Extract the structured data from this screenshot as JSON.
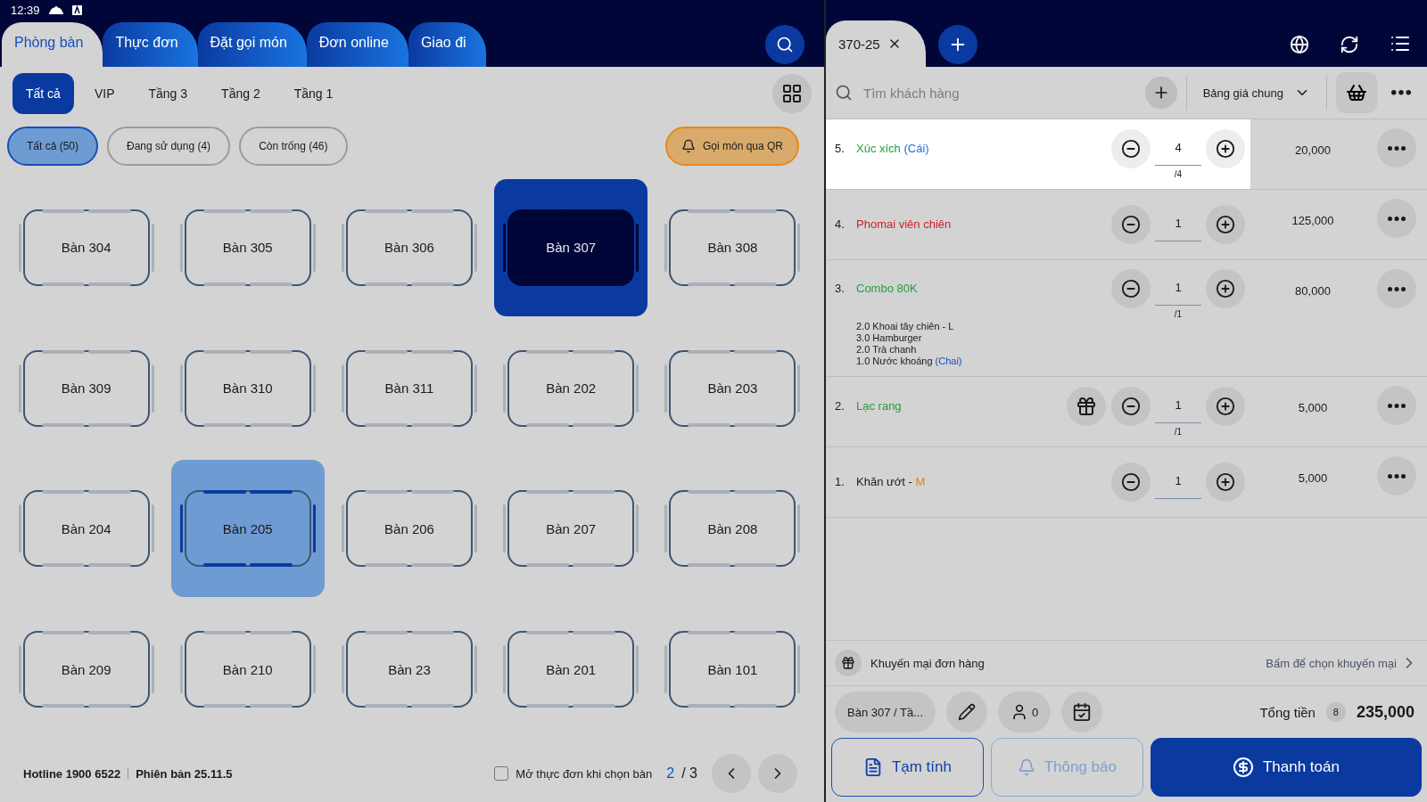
{
  "status_bar": {
    "time": "12:39"
  },
  "left": {
    "tabs": [
      {
        "label": "Phòng bàn",
        "selected": true
      },
      {
        "label": "Thực đơn",
        "selected": false
      },
      {
        "label": "Đặt gọi món",
        "selected": false
      },
      {
        "label": "Đơn online",
        "selected": false
      },
      {
        "label": "Giao đi",
        "selected": false
      }
    ],
    "floors": [
      {
        "label": "Tất cả",
        "selected": true
      },
      {
        "label": "VIP",
        "selected": false
      },
      {
        "label": "Tầng 3",
        "selected": false
      },
      {
        "label": "Tầng 2",
        "selected": false
      },
      {
        "label": "Tầng 1",
        "selected": false
      }
    ],
    "filters": [
      {
        "label": "Tất cả (50)",
        "selected": true
      },
      {
        "label": "Đang sử dụng (4)",
        "selected": false
      },
      {
        "label": "Còn trống (46)",
        "selected": false
      }
    ],
    "qr_button": "Gọi món qua QR",
    "tables": [
      {
        "label": "Bàn 304",
        "open": false,
        "selected": false
      },
      {
        "label": "Bàn 305",
        "open": false,
        "selected": false
      },
      {
        "label": "Bàn 306",
        "open": false,
        "selected": false
      },
      {
        "label": "Bàn 307",
        "open": true,
        "selected": false
      },
      {
        "label": "Bàn 308",
        "open": false,
        "selected": false
      },
      {
        "label": "Bàn 309",
        "open": false,
        "selected": false
      },
      {
        "label": "Bàn 310",
        "open": false,
        "selected": false
      },
      {
        "label": "Bàn 311",
        "open": false,
        "selected": false
      },
      {
        "label": "Bàn 202",
        "open": false,
        "selected": false
      },
      {
        "label": "Bàn 203",
        "open": false,
        "selected": false
      },
      {
        "label": "Bàn 204",
        "open": false,
        "selected": false
      },
      {
        "label": "Bàn 205",
        "open": false,
        "selected": true
      },
      {
        "label": "Bàn 206",
        "open": false,
        "selected": false
      },
      {
        "label": "Bàn 207",
        "open": false,
        "selected": false
      },
      {
        "label": "Bàn 208",
        "open": false,
        "selected": false
      },
      {
        "label": "Bàn 209",
        "open": false,
        "selected": false
      },
      {
        "label": "Bàn 210",
        "open": false,
        "selected": false
      },
      {
        "label": "Bàn 23",
        "open": false,
        "selected": false
      },
      {
        "label": "Bàn 201",
        "open": false,
        "selected": false
      },
      {
        "label": "Bàn 101",
        "open": false,
        "selected": false
      }
    ],
    "footer": {
      "hotline": "Hotline 1900 6522",
      "version": "Phiên bản 25.11.5",
      "open_menu_label": "Mở thực đơn khi chọn bàn",
      "open_menu_checked": false,
      "page_current": "2",
      "page_total": "/ 3"
    }
  },
  "right": {
    "order_tab": {
      "label": "370-25",
      "selected": true
    },
    "customer_search": {
      "placeholder": "Tìm khách hàng"
    },
    "price_list": "Bảng giá chung",
    "items": [
      {
        "number": "5.",
        "name": "Xúc xích",
        "color": "#22a03c",
        "suffix": {
          "text": "(Cái)",
          "color": "#1e6fd0"
        },
        "qty": "4",
        "limit": "/4",
        "price": "20,000",
        "selected": true,
        "gift": false
      },
      {
        "number": "4.",
        "name": "Phomai viên chiên",
        "color": "#d0202c",
        "qty": "1",
        "price": "125,000",
        "selected": false,
        "gift": false
      },
      {
        "number": "3.",
        "name": "Combo 80K",
        "color": "#22a03c",
        "qty": "1",
        "limit": "/1",
        "price": "80,000",
        "selected": false,
        "gift": false,
        "components": [
          {
            "text": "2.0 Khoai tây chiên - L"
          },
          {
            "text": "3.0 Hamburger"
          },
          {
            "text": "2.0 Trà chanh"
          },
          {
            "text": "1.0 Nước khoáng",
            "suffix": "(Chai)"
          }
        ]
      },
      {
        "number": "2.",
        "name": "Lạc rang",
        "color": "#22a03c",
        "qty": "1",
        "limit": "/1",
        "price": "5,000",
        "selected": false,
        "gift": true
      },
      {
        "number": "1.",
        "name": "Khăn ướt - ",
        "color": "#1a1a1a",
        "suffix": {
          "text": "M",
          "color": "#e08a00"
        },
        "qty": "1",
        "price": "5,000",
        "selected": false,
        "gift": false
      }
    ],
    "promo": {
      "label": "Khuyến mại đơn hàng",
      "hint": "Bấm để chọn khuyến mại"
    },
    "table_chip": "Bàn 307 / Tầ...",
    "guests": "0",
    "total_label": "Tổng tiền",
    "total_count": "8",
    "total": "235,000",
    "actions": [
      {
        "label": "Tạm tính",
        "kind": "draft",
        "disabled": false
      },
      {
        "label": "Thông báo",
        "kind": "notify",
        "disabled": true
      },
      {
        "label": "Thanh toán",
        "kind": "pay",
        "disabled": false
      }
    ]
  }
}
